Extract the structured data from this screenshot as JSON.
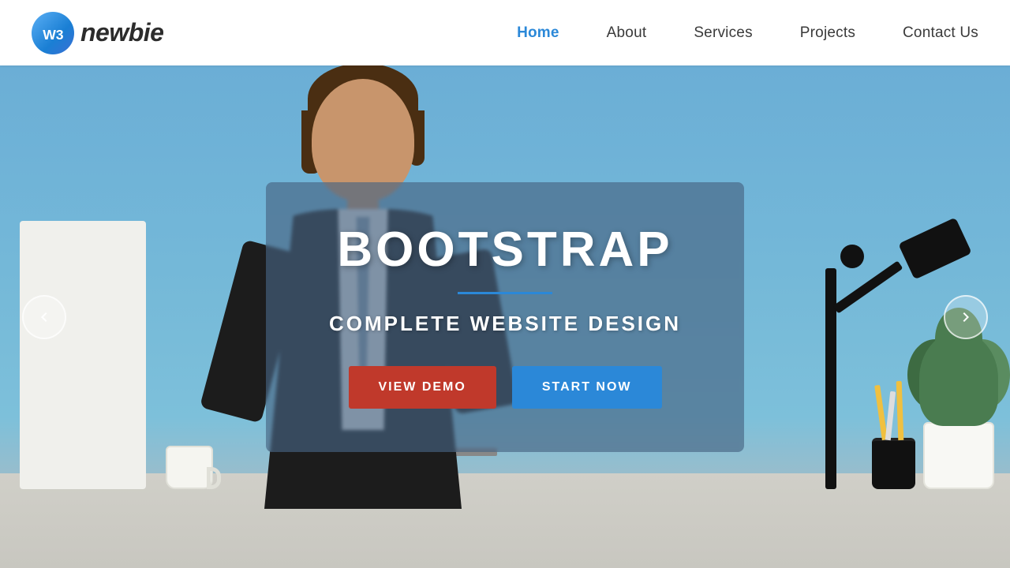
{
  "navbar": {
    "logo_text": "newbie",
    "logo_icon_label": "w3 logo",
    "links": [
      {
        "id": "home",
        "label": "Home",
        "active": true
      },
      {
        "id": "about",
        "label": "About",
        "active": false
      },
      {
        "id": "services",
        "label": "Services",
        "active": false
      },
      {
        "id": "projects",
        "label": "Projects",
        "active": false
      },
      {
        "id": "contact",
        "label": "Contact Us",
        "active": false
      }
    ]
  },
  "hero": {
    "title": "BOOTSTRAP",
    "subtitle": "COMPLETE WEBSITE DESIGN",
    "btn_demo": "VIEW DEMO",
    "btn_start": "START NOW",
    "arrow_left": "❮",
    "arrow_right": "❯"
  },
  "colors": {
    "nav_active": "#2b88d8",
    "nav_default": "#3a3a3a",
    "btn_demo_bg": "#c0392b",
    "btn_start_bg": "#2b88d8",
    "hero_bg": "#6baed6",
    "overlay_bg": "rgba(70,100,130,0.65)",
    "divider": "#2b88d8"
  }
}
